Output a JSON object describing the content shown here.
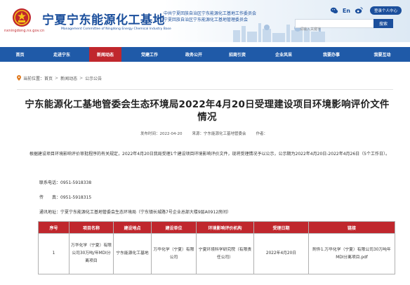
{
  "header": {
    "site_title": "宁夏宁东能源化工基地",
    "site_subtitle": "Management Committee of Ningdong Energy Chemical Industry Base",
    "domain": "nxningdong.nx.gov.cn",
    "org_line1": "中共宁夏回族自治区宁东能源化工基地工作委员会",
    "org_line2": "宁夏回族自治区宁东能源化工基地管理委员会",
    "lang_label": "En",
    "login_label": "登录个人中心",
    "search_placeholder": "请输入关键字",
    "search_button": "搜索",
    "accent_color": "#1b4f9c",
    "red_color": "#c0272d"
  },
  "nav": {
    "items": [
      {
        "label": "首页",
        "active": false
      },
      {
        "label": "走进宁东",
        "active": false
      },
      {
        "label": "新闻动态",
        "active": true
      },
      {
        "label": "党建工作",
        "active": false
      },
      {
        "label": "政务公开",
        "active": false
      },
      {
        "label": "招商引资",
        "active": false
      },
      {
        "label": "企业风采",
        "active": false
      },
      {
        "label": "我要办事",
        "active": false
      },
      {
        "label": "我要互动",
        "active": false
      }
    ]
  },
  "breadcrumb": {
    "prefix": "当前位置：",
    "items": [
      "首页",
      "新闻动态",
      "公示公告"
    ],
    "separator": ">"
  },
  "article": {
    "title": "宁东能源化工基地管委会生态环境局2022年4月20日受理建设项目环境影响评价文件情况",
    "publish_time": "发布时间：2022-04-20",
    "source": "来源：宁东能源化工基地管委会",
    "author": "作者：",
    "paragraph": "根据建设项目环境影响评价审批程序的有关规定，2022年4月20日我局受理1个建设项目环境影响评价文件，现将受理情况予以公示，公示期为2022年4月20日-2022年4月26日（5个工作日）。",
    "phone": "联系电话：0951-5918338",
    "fax": "传　　真：0951-5918315",
    "address": "通讯地址：宁夏宁东能源化工基地管委会生态环境局（宁东镇长城路7号企业总部大楼9层A0912房间）"
  },
  "table": {
    "headers": [
      "序号",
      "项目名称",
      "建设地点",
      "建设单位",
      "环境影响评价机构",
      "受理日期",
      "链接"
    ],
    "rows": [
      {
        "index": "1",
        "project": "万华化学（宁夏）有限公司30万吨/年MDI分离项目",
        "location": "宁东能源化工基地",
        "unit": "万华化学（宁夏）有限公司",
        "agency": "宁夏环境科学研究院（有限责任公司）",
        "date": "2022年4月20日",
        "link": "附件1.万华化学（宁夏）有限公司30万吨年MDI分离项目.pdf"
      }
    ]
  },
  "icons": {
    "emblem": "national-emblem-icon",
    "wechat": "wechat-icon",
    "weibo": "weibo-icon",
    "location": "location-pin-icon"
  }
}
